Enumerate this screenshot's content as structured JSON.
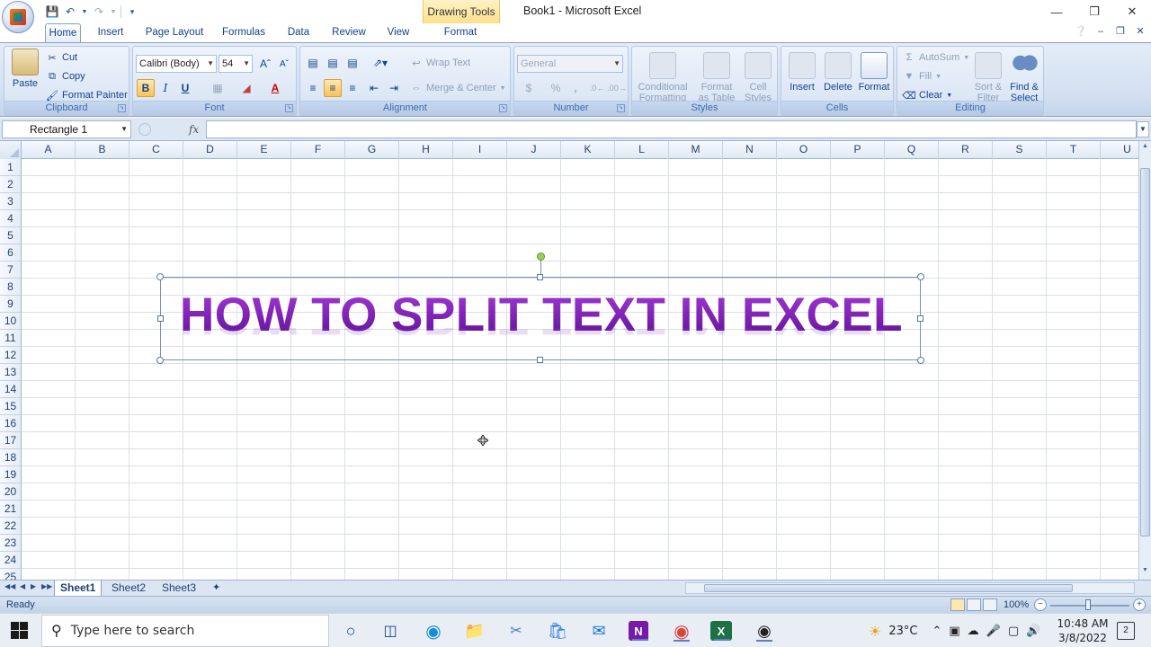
{
  "app": {
    "window_title": "Book1 - Microsoft Excel",
    "contextual_tab_group": "Drawing Tools"
  },
  "tabs": [
    {
      "label": "Home",
      "active": true
    },
    {
      "label": "Insert"
    },
    {
      "label": "Page Layout"
    },
    {
      "label": "Formulas"
    },
    {
      "label": "Data"
    },
    {
      "label": "Review"
    },
    {
      "label": "View"
    },
    {
      "label": "Format"
    }
  ],
  "ribbon": {
    "clipboard": {
      "label": "Clipboard",
      "paste": "Paste",
      "cut": "Cut",
      "copy": "Copy",
      "format_painter": "Format Painter"
    },
    "font": {
      "label": "Font",
      "name": "Calibri (Body)",
      "size": "54",
      "bold": "B",
      "italic": "I",
      "underline": "U"
    },
    "alignment": {
      "label": "Alignment",
      "wrap_text": "Wrap Text",
      "merge_center": "Merge & Center"
    },
    "number": {
      "label": "Number",
      "format": "General",
      "currency": "$",
      "percent": "%",
      "comma": ","
    },
    "styles": {
      "label": "Styles",
      "conditional": [
        "Conditional",
        "Formatting"
      ],
      "format_table": [
        "Format",
        "as Table"
      ],
      "cell_styles": [
        "Cell",
        "Styles"
      ]
    },
    "cells": {
      "label": "Cells",
      "insert": "Insert",
      "delete": "Delete",
      "format": "Format"
    },
    "editing": {
      "label": "Editing",
      "autosum": "AutoSum",
      "fill": "Fill",
      "clear": "Clear",
      "sort_filter": [
        "Sort &",
        "Filter"
      ],
      "find_select": [
        "Find &",
        "Select"
      ]
    }
  },
  "formula_bar": {
    "name_box": "Rectangle 1",
    "fx": "fx",
    "value": ""
  },
  "grid": {
    "columns": [
      "A",
      "B",
      "C",
      "D",
      "E",
      "F",
      "G",
      "H",
      "I",
      "J",
      "K",
      "L",
      "M",
      "N",
      "O",
      "P",
      "Q",
      "R",
      "S",
      "T",
      "U"
    ],
    "rows": [
      "1",
      "2",
      "3",
      "4",
      "5",
      "6",
      "7",
      "8",
      "9",
      "10",
      "11",
      "12",
      "13",
      "14",
      "15",
      "16",
      "17",
      "18",
      "19",
      "20",
      "21",
      "22",
      "23",
      "24",
      "25"
    ]
  },
  "wordart": {
    "text": "HOW TO SPLIT TEXT IN EXCEL",
    "color": "#7a1fb0"
  },
  "sheet_tabs": [
    {
      "label": "Sheet1",
      "active": true
    },
    {
      "label": "Sheet2"
    },
    {
      "label": "Sheet3"
    }
  ],
  "status": {
    "text": "Ready",
    "zoom": "100%"
  },
  "taskbar": {
    "search_placeholder": "Type here to search",
    "temperature": "23°C",
    "time": "10:48 AM",
    "date": "3/8/2022",
    "notifications": "2",
    "apps": [
      "cortana-icon",
      "task-view-icon",
      "edge-icon",
      "file-explorer-icon",
      "snipping-icon",
      "store-icon",
      "mail-icon",
      "onenote-icon",
      "chrome-icon",
      "excel-icon",
      "obs-icon"
    ]
  }
}
